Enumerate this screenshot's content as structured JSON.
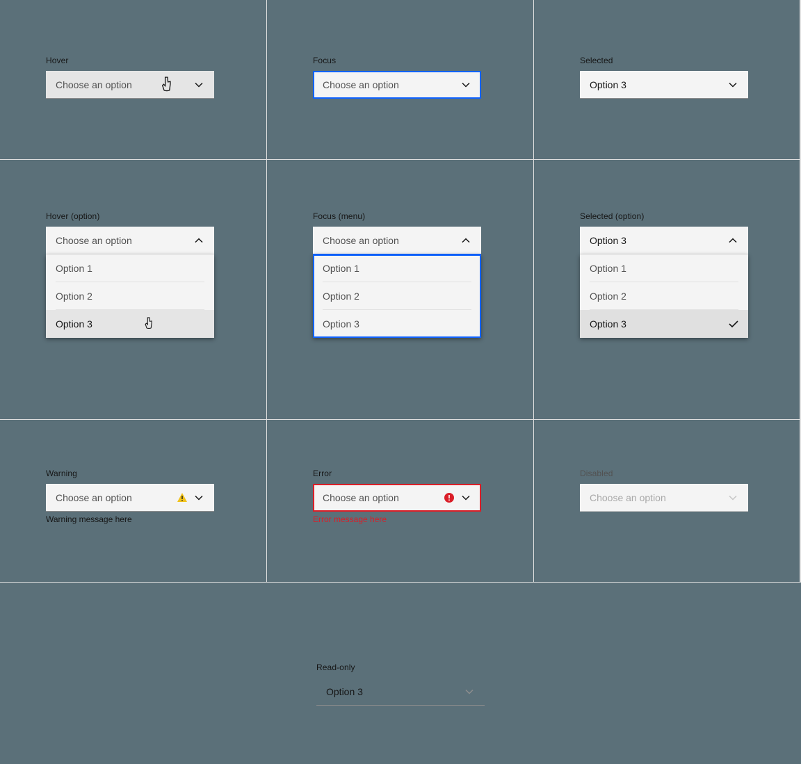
{
  "labels": {
    "hover": "Hover",
    "focus": "Focus",
    "selected": "Selected",
    "hover_option": "Hover (option)",
    "focus_menu": "Focus (menu)",
    "selected_option": "Selected (option)",
    "warning": "Warning",
    "error": "Error",
    "disabled": "Disabled",
    "readonly": "Read-only"
  },
  "placeholder": "Choose an option",
  "selected_value": "Option 3",
  "options": [
    "Option 1",
    "Option 2",
    "Option 3"
  ],
  "warning_msg": "Warning message here",
  "error_msg": "Error message here",
  "colors": {
    "focus": "#0f62fe",
    "error": "#da1e28",
    "warning": "#f1c21b"
  }
}
